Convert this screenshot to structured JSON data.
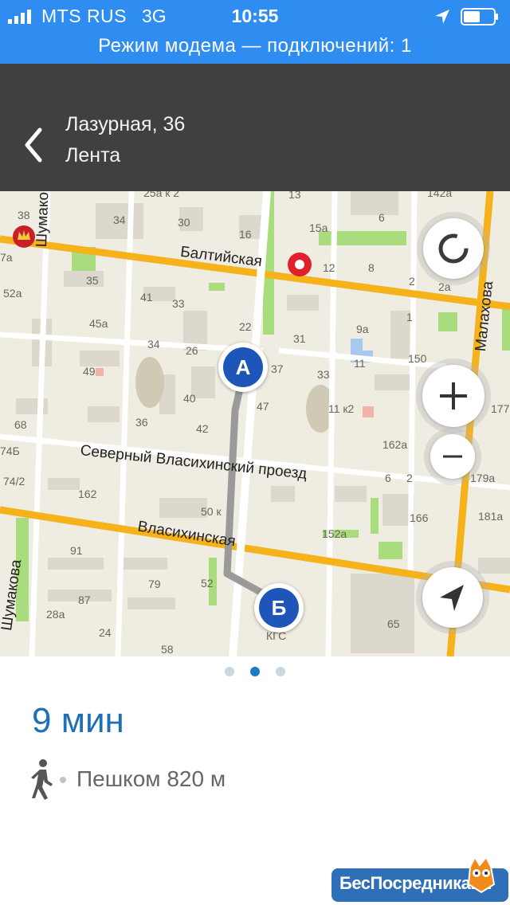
{
  "status_bar": {
    "carrier": "MTS RUS",
    "network": "3G",
    "time": "10:55"
  },
  "hotspot_banner": "Режим модема — подключений: 1",
  "header": {
    "title": "Лазурная, 36",
    "subtitle": "Лента"
  },
  "map": {
    "streets": [
      "Балтийская",
      "Северный Власихинский проезд",
      "Власихинская",
      "Шумакова",
      "Шумакова",
      "Малахова"
    ],
    "house_numbers": [
      "25а к 2",
      "13",
      "142а",
      "38",
      "34",
      "30",
      "16",
      "6",
      "15а",
      "12",
      "8",
      "2",
      "2а",
      "7а",
      "35",
      "52а",
      "41",
      "33",
      "45а",
      "22",
      "1",
      "9а",
      "31",
      "34",
      "26",
      "11",
      "150",
      "49",
      "37",
      "33",
      "40",
      "47",
      "11 к2",
      "36",
      "42",
      "162а",
      "68",
      "74Б",
      "74/2",
      "162",
      "6",
      "2",
      "50 к",
      "166",
      "179а",
      "152а",
      "181а",
      "91",
      "79",
      "52",
      "87",
      "65",
      "28а",
      "24",
      "58",
      "177",
      "КГС"
    ],
    "route_start": "А",
    "route_end": "Б",
    "colors": {
      "major_road": "#f5b21a",
      "route": "#9a9a9a",
      "marker": "#1d56b8",
      "park": "#a9dc7c"
    }
  },
  "pager": {
    "pages": 3,
    "active": 2
  },
  "route_info": {
    "duration": "9 мин",
    "mode": "Пешком 820 м"
  },
  "watermark": "БесПосредника.ru"
}
